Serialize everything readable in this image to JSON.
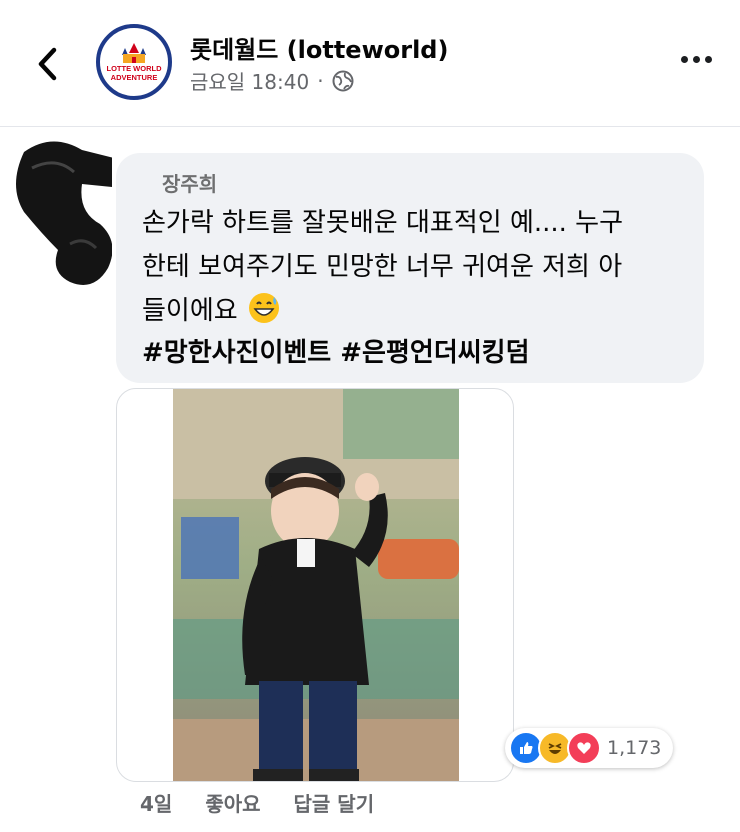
{
  "header": {
    "page_name": "롯데월드 (lotteworld)",
    "timestamp": "금요일 18:40",
    "separator": "·",
    "logo_line1": "LOTTE WORLD",
    "logo_line2": "ADVENTURE",
    "back_icon": "chevron-left-icon",
    "privacy_icon": "globe-icon",
    "more_icon": "ellipsis-icon"
  },
  "comment": {
    "author": "장주희",
    "line1": "손가락 하트를 잘못배운 대표적인 예.... 누구",
    "line2": "한테 보여주기도 민망한 너무 귀여운 저희 아",
    "line3": "들이에요",
    "emoji": "grinning-sweat-emoji",
    "hashtags": "#망한사진이벤트 #은평언더씨킹덤"
  },
  "reactions": {
    "types": [
      "like",
      "haha",
      "love"
    ],
    "count": "1,173",
    "colors": {
      "like": "#1877f2",
      "haha": "#f7b928",
      "love": "#f33e58"
    }
  },
  "actions": {
    "time": "4일",
    "like": "좋아요",
    "reply": "답글 달기"
  }
}
